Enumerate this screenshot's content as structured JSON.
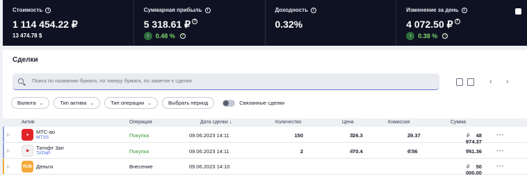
{
  "stats": [
    {
      "label": "Стоимость",
      "value": "1 114 454.22 ₽",
      "sub": "13 474.78 $"
    },
    {
      "label": "Суммарная прибыль",
      "value": "5 318.61 ₽",
      "gain": "0.48 %"
    },
    {
      "label": "Доходность",
      "value": "0.32%"
    },
    {
      "label": "Изменение за день",
      "value": "4 072.50 ₽",
      "gain": "0.38 %"
    }
  ],
  "deals": {
    "title": "Сделки",
    "search_placeholder": "Поиск по названию бумаги, по тикеру бумаги, по заметке к сделке",
    "filters": [
      "Валюта",
      "Тип актива",
      "Тип операции"
    ],
    "period_button": "Выбрать период",
    "linked_toggle": "Связанные сделки",
    "columns": {
      "asset": "Актив",
      "operation": "Операция",
      "date": "Дата сделки ↓",
      "qty": "Количество",
      "price": "Цена",
      "commission": "Комиссия",
      "sum": "Сумма"
    },
    "rows": [
      {
        "name": "МТС-ао",
        "ticker": "MTSS",
        "logo": "",
        "operation": "Покупка",
        "date": "09.06.2023 14:11",
        "qty": "150",
        "price": "326.3",
        "commission": "29.37",
        "sum": "48 974.37",
        "dots": "•••"
      },
      {
        "name": "Татнфт 3ап",
        "ticker": "TATNP",
        "logo": "",
        "operation": "Покупка",
        "date": "09.06.2023 14:11",
        "qty": "2",
        "price": "470.4",
        "commission": "0.56",
        "sum": "941.36",
        "dots": "•••"
      },
      {
        "name": "Деньги",
        "ticker": "",
        "logo": "RUB",
        "operation": "Внесение",
        "date": "09.06.2023 14:10",
        "qty": "",
        "price": "",
        "commission": "",
        "sum": "50 000.00",
        "dots": "•••"
      }
    ],
    "currency_symbol": "₽"
  },
  "colors": {
    "header_bg": "#0f1222",
    "gain": "#7fd86b",
    "buy": "#3a9a3a",
    "link": "#3f64d6",
    "mts": "#e3232a",
    "tatneft": "#d83a3a",
    "rub": "#f4a93a"
  }
}
